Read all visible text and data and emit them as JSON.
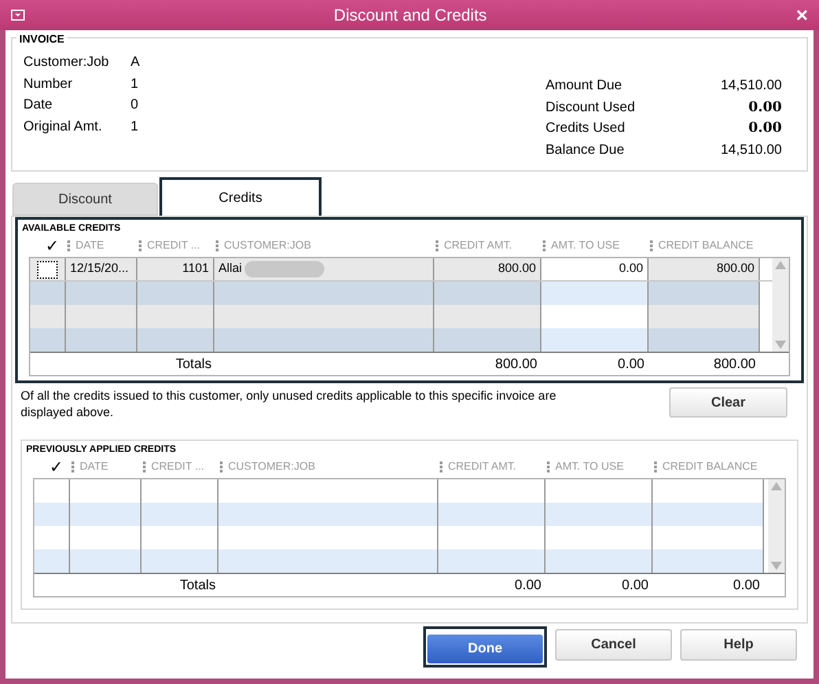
{
  "window": {
    "title": "Discount and Credits",
    "close": "×"
  },
  "invoice": {
    "heading": "INVOICE",
    "left": [
      {
        "label": "Customer:Job",
        "value": "A"
      },
      {
        "label": "Number",
        "value": "1"
      },
      {
        "label": "Date",
        "value": "0"
      },
      {
        "label": "Original Amt.",
        "value": "1"
      }
    ],
    "right": [
      {
        "label": "Amount Due",
        "value": "14,510.00",
        "bold": false
      },
      {
        "label": "Discount Used",
        "value": "0.00",
        "bold": true
      },
      {
        "label": "Credits Used",
        "value": "0.00",
        "bold": true
      },
      {
        "label": "Balance Due",
        "value": "14,510.00",
        "bold": false
      }
    ]
  },
  "tabs": [
    {
      "label": "Discount",
      "selected": false
    },
    {
      "label": "Credits",
      "selected": true
    }
  ],
  "available_credits": {
    "heading": "AVAILABLE CREDITS",
    "check_header": "✓",
    "columns": [
      "DATE",
      "CREDIT ...",
      "CUSTOMER:JOB",
      "CREDIT AMT.",
      "AMT. TO USE",
      "CREDIT BALANCE"
    ],
    "rows": [
      {
        "checked": false,
        "cells": [
          "12/15/20...",
          "1101",
          "Allai",
          "800.00",
          "0.00",
          "800.00"
        ],
        "redacted": true
      }
    ],
    "totals_label": "Totals",
    "totals": [
      "800.00",
      "0.00",
      "800.00"
    ]
  },
  "note": "Of all the credits issued to this customer, only unused credits applicable to this specific invoice are displayed above.",
  "clear_button": "Clear",
  "previously_applied_credits": {
    "heading": "PREVIOUSLY APPLIED CREDITS",
    "check_header": "✓",
    "columns": [
      "DATE",
      "CREDIT ...",
      "CUSTOMER:JOB",
      "CREDIT AMT.",
      "AMT. TO USE",
      "CREDIT BALANCE"
    ],
    "totals_label": "Totals",
    "totals": [
      "0.00",
      "0.00",
      "0.00"
    ]
  },
  "buttons": [
    {
      "label": "Done",
      "kind": "primary"
    },
    {
      "label": "Cancel",
      "kind": "normal"
    },
    {
      "label": "Help",
      "kind": "normal"
    }
  ]
}
